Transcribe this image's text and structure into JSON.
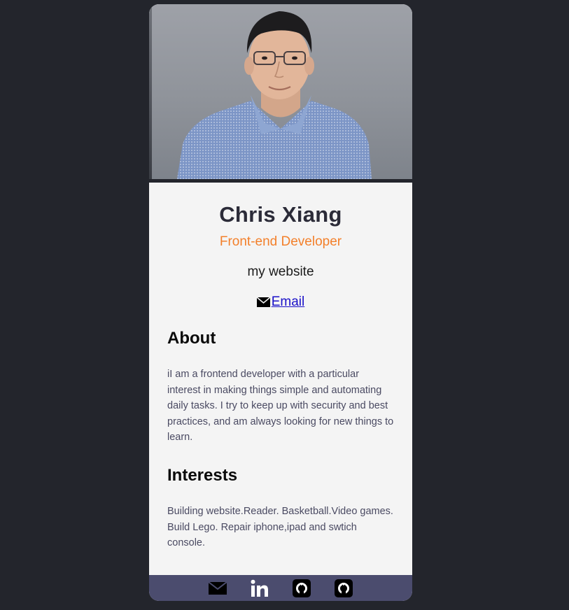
{
  "profile": {
    "name": "Chris Xiang",
    "role": "Front-end Developer",
    "website_label": "my website",
    "email_label": " Email"
  },
  "about": {
    "heading": "About",
    "text": "iI am a frontend developer with a particular interest in making things simple and automating daily tasks. I try to keep up with security and best practices, and am always looking for new things to learn."
  },
  "interests": {
    "heading": "Interests",
    "text": "Building website.Reader. Basketball.Video games. Build Lego. Repair iphone,ipad and swtich console."
  },
  "footer": {
    "icons": [
      "mail-icon",
      "linkedin-icon",
      "github-icon",
      "github-icon"
    ]
  },
  "colors": {
    "background": "#23252c",
    "card": "#f4f4f4",
    "name": "#2b2b38",
    "accent": "#f3802b",
    "link": "#1a10c8",
    "footer": "#4b4c6e"
  }
}
